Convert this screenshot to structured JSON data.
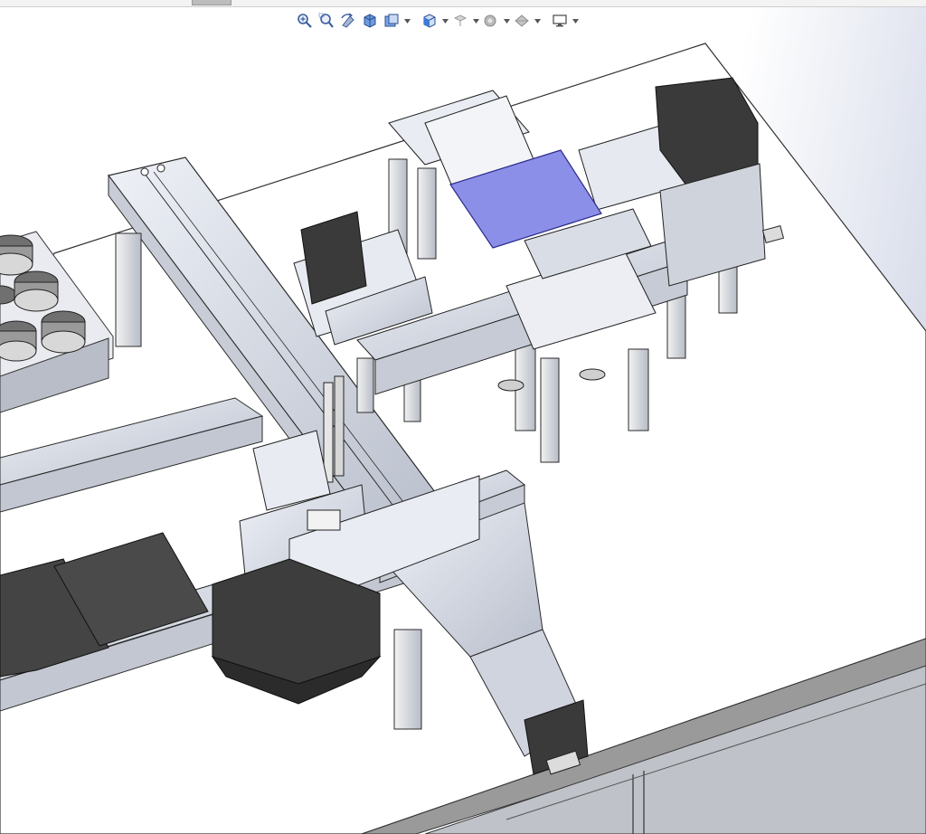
{
  "window": {
    "title": ""
  },
  "view_toolbar": {
    "tools": [
      {
        "name": "zoom-to-fit-icon"
      },
      {
        "name": "zoom-to-area-icon"
      },
      {
        "name": "previous-view-icon"
      },
      {
        "name": "section-view-icon"
      },
      {
        "name": "dynamic-annotation-icon"
      },
      {
        "name": "view-orientation-icon"
      },
      {
        "name": "display-style-icon"
      },
      {
        "name": "hide-show-items-icon"
      },
      {
        "name": "edit-appearance-icon"
      },
      {
        "name": "apply-scene-icon"
      },
      {
        "name": "view-settings-icon"
      }
    ]
  },
  "colors": {
    "background_left": "#ffffff",
    "background_right": "#c9cfdf",
    "aluminum": "#d8dce6",
    "aluminum_edge": "#2b2b2b",
    "motor_dark": "#3a3a3a",
    "selected_plate": "#8b8fe8",
    "floor_table": "#ffffff"
  }
}
